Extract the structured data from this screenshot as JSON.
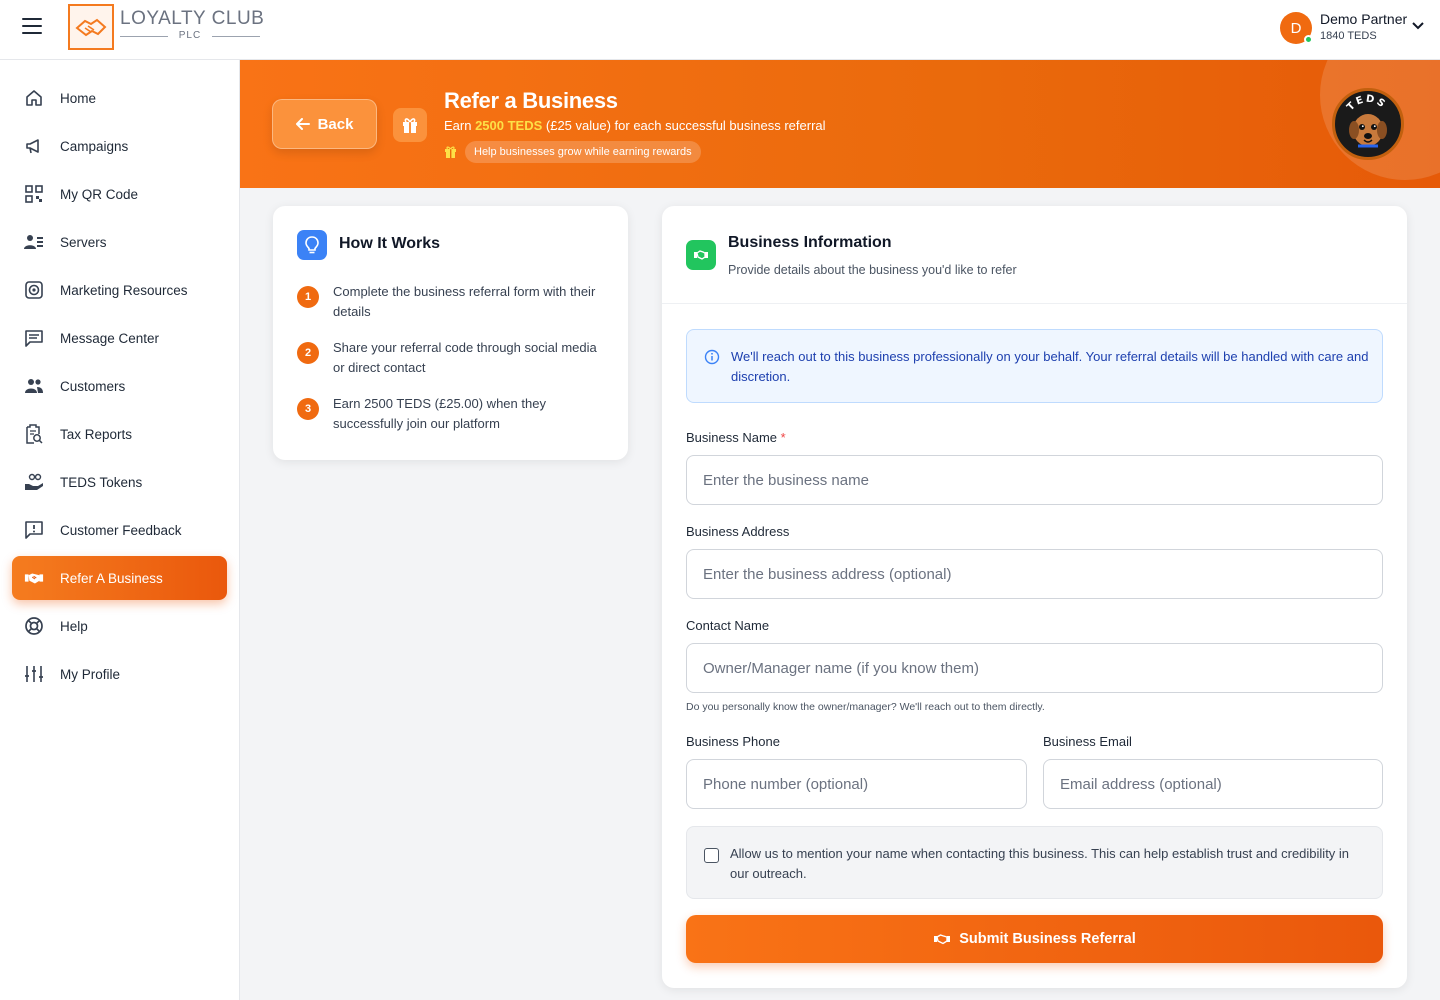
{
  "header": {
    "logo_title": "LOYALTY CLUB",
    "logo_sub": "PLC",
    "user": {
      "initial": "D",
      "name": "Demo Partner",
      "teds": "1840 TEDS"
    }
  },
  "sidebar": {
    "items": [
      {
        "label": "Home",
        "icon": "home-icon"
      },
      {
        "label": "Campaigns",
        "icon": "megaphone-icon"
      },
      {
        "label": "My QR Code",
        "icon": "qr-code-icon"
      },
      {
        "label": "Servers",
        "icon": "users-list-icon"
      },
      {
        "label": "Marketing Resources",
        "icon": "target-icon"
      },
      {
        "label": "Message Center",
        "icon": "message-icon"
      },
      {
        "label": "Customers",
        "icon": "customers-icon"
      },
      {
        "label": "Tax Reports",
        "icon": "tax-report-icon"
      },
      {
        "label": "TEDS Tokens",
        "icon": "tokens-hand-icon"
      },
      {
        "label": "Customer Feedback",
        "icon": "feedback-icon"
      },
      {
        "label": "Refer A Business",
        "icon": "handshake-icon",
        "active": true
      },
      {
        "label": "Help",
        "icon": "lifebuoy-icon"
      },
      {
        "label": "My Profile",
        "icon": "sliders-icon"
      }
    ]
  },
  "hero": {
    "back_label": "Back",
    "title": "Refer a Business",
    "subtitle_prefix": "Earn ",
    "subtitle_highlight": "2500 TEDS",
    "subtitle_suffix": " (£25 value) for each successful business referral",
    "pill": "Help businesses grow while earning rewards",
    "badge_text": "TEDS"
  },
  "how_it_works": {
    "title": "How It Works",
    "steps": [
      {
        "num": "1",
        "text": "Complete the business referral form with their details"
      },
      {
        "num": "2",
        "text": "Share your referral code through social media or direct contact"
      },
      {
        "num": "3",
        "text": "Earn 2500 TEDS (£25.00) when they successfully join our platform"
      }
    ]
  },
  "form": {
    "title": "Business Information",
    "description": "Provide details about the business you'd like to refer",
    "info": "We'll reach out to this business professionally on your behalf. Your referral details will be handled with care and discretion.",
    "business_name": {
      "label": "Business Name",
      "required_mark": "*",
      "placeholder": "Enter the business name"
    },
    "business_address": {
      "label": "Business Address",
      "placeholder": "Enter the business address (optional)"
    },
    "contact_name": {
      "label": "Contact Name",
      "placeholder": "Owner/Manager name (if you know them)",
      "hint": "Do you personally know the owner/manager? We'll reach out to them directly."
    },
    "business_phone": {
      "label": "Business Phone",
      "placeholder": "Phone number (optional)"
    },
    "business_email": {
      "label": "Business Email",
      "placeholder": "Email address (optional)"
    },
    "consent": "Allow us to mention your name when contacting this business. This can help establish trust and credibility in our outreach.",
    "submit_label": "Submit Business Referral"
  },
  "colors": {
    "accent": "#f97316",
    "accent_dark": "#ea580c",
    "info_blue": "#1e40af",
    "success_green": "#22c55e"
  }
}
